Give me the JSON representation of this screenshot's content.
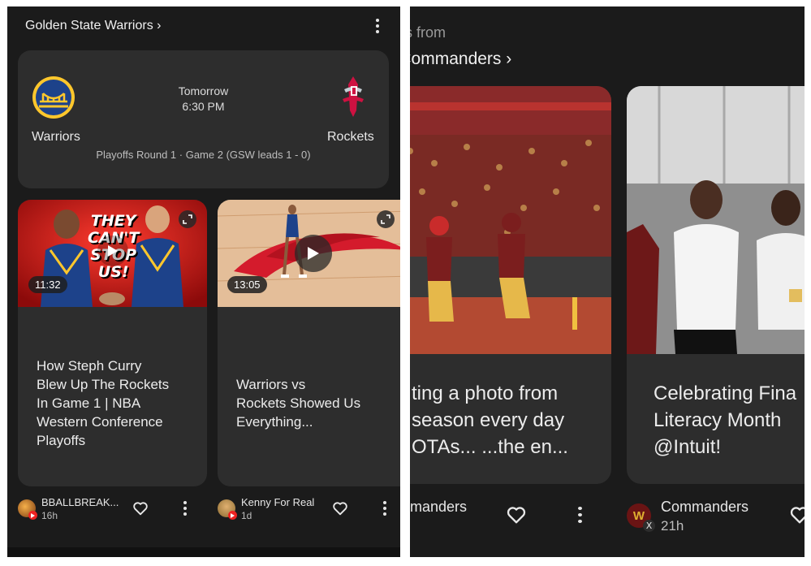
{
  "left": {
    "header": {
      "team_link": "Golden State Warriors ›"
    },
    "game": {
      "day": "Tomorrow",
      "time": "6:30 PM",
      "home_team": "Warriors",
      "away_team": "Rockets",
      "series": "Playoffs Round 1 · Game 2 (GSW leads 1 - 0)"
    },
    "videos": [
      {
        "thumb_text": [
          "THEY",
          "CAN'T",
          "STOP",
          "US!"
        ],
        "duration": "11:32",
        "title_lines": [
          "How Steph Curry",
          "Blew Up The Rockets",
          "In Game 1 | NBA",
          "Western Conference",
          "Playoffs"
        ],
        "source": "BBALLBREAK...",
        "age": "16h"
      },
      {
        "duration": "13:05",
        "title_lines": [
          "Warriors vs",
          "Rockets Showed Us",
          "Everything..."
        ],
        "source": "Kenny For Real",
        "age": "1d"
      }
    ]
  },
  "right": {
    "subtitle": "osts from",
    "title": "ngton Commanders ›",
    "posts": [
      {
        "text_lines": [
          "ting a photo from",
          " season every day",
          " OTAs... ...the en..."
        ],
        "source": "manders"
      },
      {
        "text_lines": [
          "Celebrating Fina",
          "Literacy Month",
          "@Intuit!"
        ],
        "source": "Commanders",
        "age": "21h"
      }
    ]
  },
  "colors": {
    "background": "#1b1b1b",
    "card": "#2d2d2d",
    "warriors_blue": "#1d428a",
    "warriors_gold": "#ffc72c",
    "rockets_red": "#ce1141",
    "commanders_burgundy": "#5a1414",
    "youtube_red": "#e22222"
  },
  "icons": [
    "kebab-menu-icon",
    "warriors-logo",
    "rockets-logo",
    "expand-icon",
    "play-icon",
    "heart-icon",
    "youtube-badge-icon",
    "x-badge-icon"
  ]
}
